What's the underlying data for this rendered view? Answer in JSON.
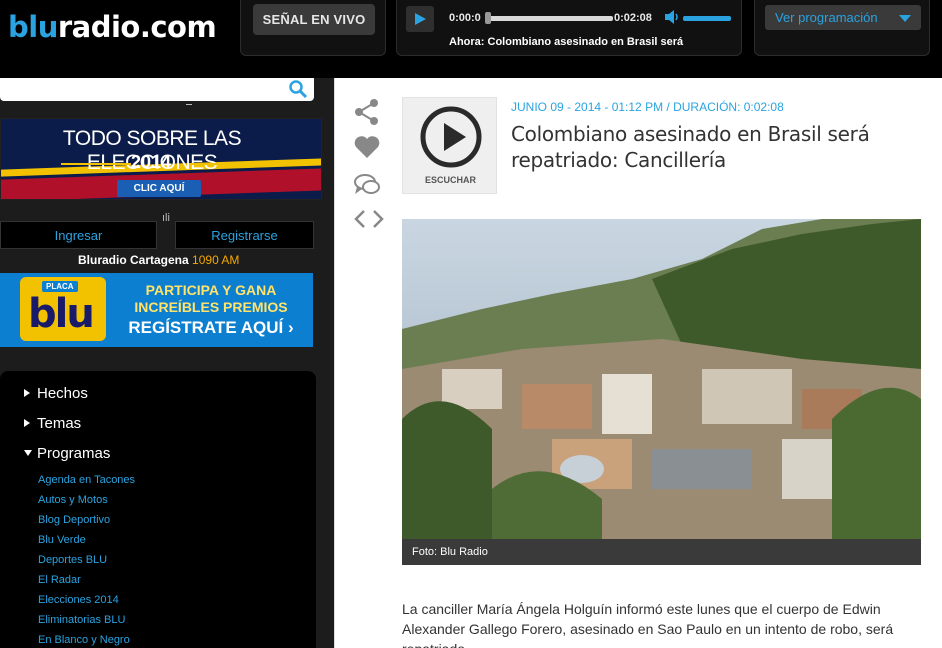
{
  "header": {
    "logo_blu": "blu",
    "logo_rest": "radio.com",
    "live_label": "SEÑAL EN VIVO",
    "time_start": "0:00:0",
    "time_end": "0:02:08",
    "now_playing": "Ahora: Colombiano asesinado en Brasil será",
    "programming_label": "Ver programación"
  },
  "sidebar": {
    "search_placeholder": "",
    "elecciones_title": "TODO SOBRE LAS ELECCIONES",
    "elecciones_year": "2014",
    "elecciones_cta": "CLIC AQUÍ",
    "auth_stub": "ıli",
    "login_label": "Ingresar",
    "register_label": "Registrarse",
    "station_name": "Bluradio Cartagena",
    "station_freq": "1090 AM",
    "placa_tag": "PLACA",
    "placa_logo": "blu",
    "placa_line1": "PARTICIPA Y GANA",
    "placa_line2": "INCREÍBLES PREMIOS",
    "placa_line3": "REGÍSTRATE AQUÍ ›",
    "menu_sections": [
      {
        "label": "Hechos",
        "expanded": false
      },
      {
        "label": "Temas",
        "expanded": false
      },
      {
        "label": "Programas",
        "expanded": true
      }
    ],
    "programas": [
      "Agenda en Tacones",
      "Autos y Motos",
      "Blog Deportivo",
      "Blu Verde",
      "Deportes BLU",
      "El Radar",
      "Elecciones 2014",
      "Eliminatorias BLU",
      "En Blanco y Negro"
    ]
  },
  "article": {
    "listen_label": "ESCUCHAR",
    "meta": "JUNIO 09 - 2014 - 01:12 PM / DURACIÓN: 0:02:08",
    "title": "Colombiano asesinado en Brasil será repatriado: Cancillería",
    "photo_caption": "Foto: Blu Radio",
    "body": "La canciller María Ángela Holguín informó este lunes que el cuerpo de Edwin Alexander Gallego Forero, asesinado en Sao Paulo en un intento de robo, será repatriado."
  },
  "icons": {
    "play": "play-icon",
    "volume": "volume-icon",
    "search": "search-icon",
    "share": "share-icon",
    "like": "heart-icon",
    "comment": "comment-icon",
    "embed": "embed-icon"
  },
  "colors": {
    "accent": "#2aa3e0",
    "topbar_bg": "#000000",
    "sidebar_bg": "#1c1c1c",
    "frequency": "#f2a900"
  }
}
